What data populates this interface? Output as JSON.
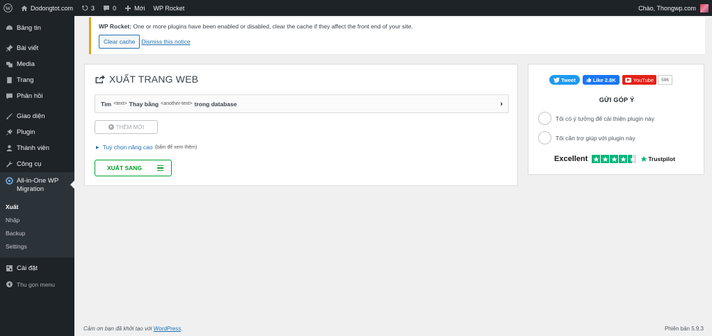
{
  "adminbar": {
    "site_name": "Dodongtot.com",
    "updates_count": "3",
    "comments_count": "0",
    "new_label": "Mới",
    "wp_rocket_label": "WP Rocket",
    "greeting": "Chào, Thongwp.com"
  },
  "sidebar": {
    "items": [
      {
        "label": "Bảng tin",
        "icon": "dashboard-icon"
      },
      {
        "label": "Bài viết",
        "icon": "pin-icon"
      },
      {
        "label": "Media",
        "icon": "media-icon"
      },
      {
        "label": "Trang",
        "icon": "page-icon"
      },
      {
        "label": "Phản hồi",
        "icon": "comment-icon"
      },
      {
        "label": "Giao diện",
        "icon": "brush-icon"
      },
      {
        "label": "Plugin",
        "icon": "plugin-icon"
      },
      {
        "label": "Thành viên",
        "icon": "user-icon"
      },
      {
        "label": "Công cụ",
        "icon": "wrench-icon"
      }
    ],
    "aio_label": "All-in-One WP Migration",
    "submenu": [
      "Xuất",
      "Nhập",
      "Backup",
      "Settings"
    ],
    "settings_label": "Cài đặt",
    "collapse_label": "Thu gọn menu"
  },
  "notice": {
    "brand": "WP Rocket:",
    "message": "One or more plugins have been enabled or disabled, clear the cache if they affect the front end of your site.",
    "clear_cache_label": "Clear cache",
    "dismiss_label": "Dismiss this notice"
  },
  "export": {
    "title": "XUẤT TRANG WEB",
    "find_label": "Tìm",
    "find_code": "<text>",
    "replace_label": "Thay bằng",
    "replace_code": "<another-text>",
    "in_db_label": "trong database",
    "add_new_label": "THÊM MỚI",
    "advanced_label": "Tuỳ chọn nâng cao",
    "advanced_hint": "(bấm để xem thêm)",
    "export_to_label": "XUẤT SANG"
  },
  "side": {
    "tweet_label": "Tweet",
    "like_label": "Like 2.8K",
    "youtube_label": "YouTube",
    "youtube_count": "596",
    "feedback_title": "GỬI GÓP Ý",
    "option_1": "Tôi có ý tưởng để cải thiện plugin này",
    "option_2": "Tôi cần trợ giúp với plugin này",
    "trustpilot_rating": "Excellent",
    "trustpilot_brand": "Trustpilot",
    "trustpilot_stars": 4.5
  },
  "footer": {
    "thanks_prefix": "Cảm ơn bạn đã khởi tạo với ",
    "thanks_link": "WordPress",
    "thanks_suffix": ".",
    "version": "Phiên bản 5.9.3"
  }
}
